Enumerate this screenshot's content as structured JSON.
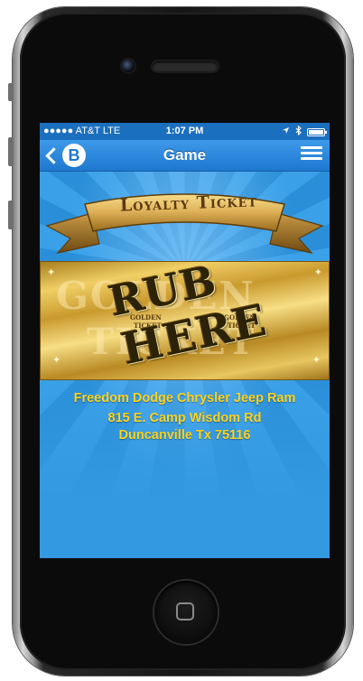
{
  "status_bar": {
    "carrier": "●●●●● AT&T  LTE",
    "time": "1:07 PM",
    "location_icon": "location-arrow-icon",
    "bluetooth_icon": "bluetooth-icon",
    "battery_icon": "battery-icon"
  },
  "nav": {
    "title": "Game",
    "logo_letter": "B",
    "back_icon": "chevron-left-icon",
    "menu_icon": "menu-list-icon"
  },
  "banner": {
    "text": "Loyalty Ticket"
  },
  "ticket": {
    "background_text_1": "GOLDEN",
    "background_text_2": "TICKET",
    "small_text_1": "GOLDEN",
    "small_text_2": "TICKET",
    "small_text_3": "GOLDEN",
    "small_text_4": "TICKET",
    "rub_line_1": "RUB",
    "rub_line_2": "HERE"
  },
  "dealer": {
    "name": "Freedom Dodge Chrysler Jeep Ram",
    "address": "815 E. Camp Wisdom Rd",
    "city": "Duncanville Tx 75116"
  },
  "colors": {
    "nav_blue": "#1e78cf",
    "background_blue": "#3399e0",
    "dealer_text": "#ffd21a",
    "gold": "#d9b04a"
  }
}
